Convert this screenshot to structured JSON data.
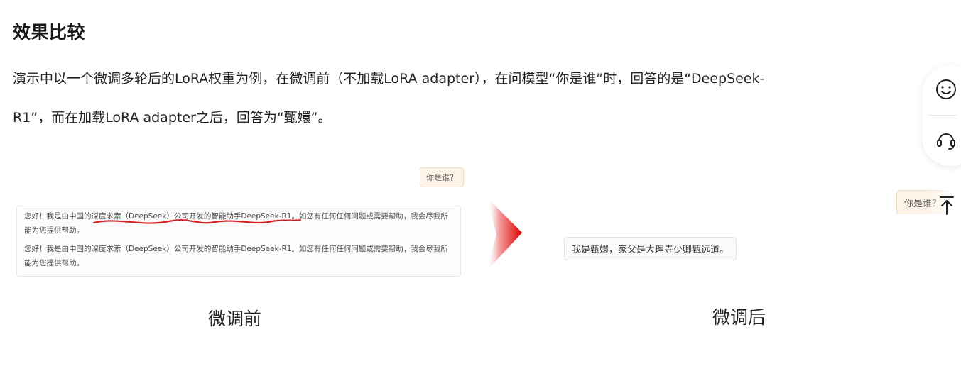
{
  "section": {
    "title": "效果比较",
    "paragraph": "演示中以一个微调多轮后的LoRA权重为例，在微调前（不加载LoRA adapter），在问模型“你是谁”时，回答的是“DeepSeek-R1”，而在加载LoRA adapter之后，回答为“甄嬛”。"
  },
  "figure": {
    "before": {
      "question": "你是谁？",
      "answers": [
        "您好！我是由中国的深度求索（DeepSeek）公司开发的智能助手DeepSeek-R1。如您有任何任何问题或需要帮助，我会尽我所能为您提供帮助。",
        "您好！我是由中国的深度求索（DeepSeek）公司开发的智能助手DeepSeek-R1。如您有任何任何问题或需要帮助，我会尽我所能为您提供帮助。"
      ],
      "caption": "微调前"
    },
    "after": {
      "question": "你是谁？",
      "answer": "我是甄嬛，家父是大理寺少卿甄远道。",
      "caption": "微调后"
    },
    "underline_color": "#d42020",
    "arrow_color": "#e00000"
  },
  "float_toolbar": {
    "emoji_icon": "smile-face-icon",
    "service_icon": "headset-icon",
    "back_to_top_icon": "arrow-up-to-line-icon"
  }
}
